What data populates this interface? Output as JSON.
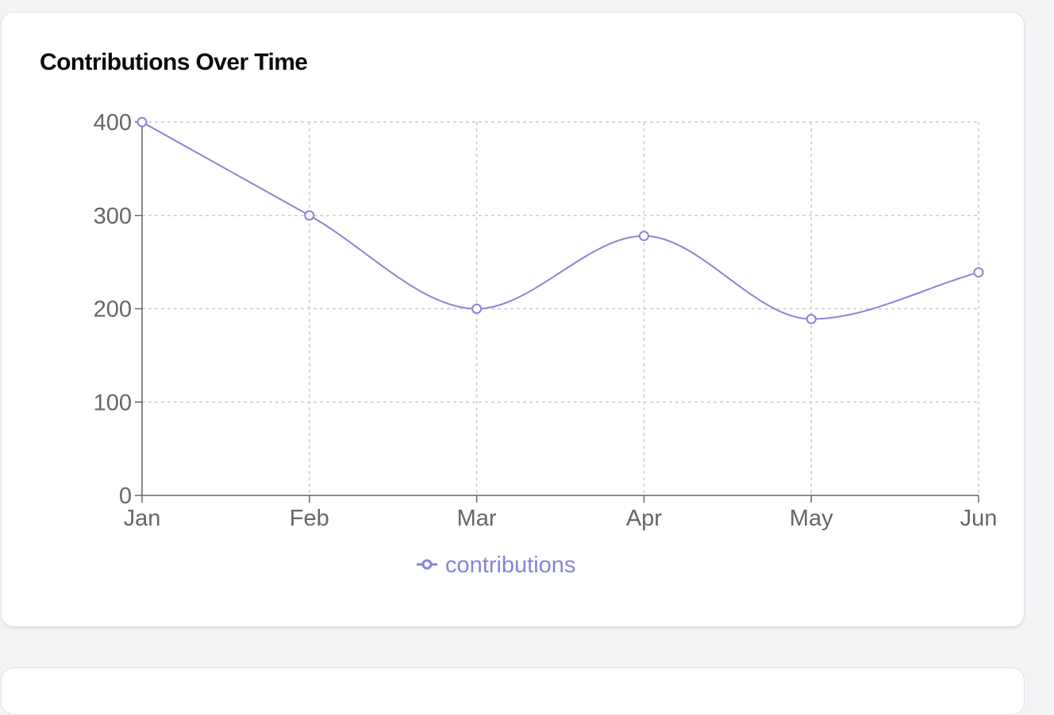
{
  "card": {
    "title": "Contributions Over Time"
  },
  "colors": {
    "series": "#8884d8",
    "grid": "#cccccc",
    "axis": "#666666",
    "background": "#f3f4f6",
    "card": "#ffffff"
  },
  "chart_data": {
    "type": "line",
    "title": "Contributions Over Time",
    "xlabel": "",
    "ylabel": "",
    "categories": [
      "Jan",
      "Feb",
      "Mar",
      "Apr",
      "May",
      "Jun"
    ],
    "series": [
      {
        "name": "contributions",
        "values": [
          400,
          300,
          200,
          278,
          189,
          239
        ]
      }
    ],
    "ylim": [
      0,
      400
    ],
    "yticks": [
      0,
      100,
      200,
      300,
      400
    ],
    "grid": true,
    "grid_style": "dashed",
    "curve": "smooth",
    "legend_position": "bottom"
  }
}
